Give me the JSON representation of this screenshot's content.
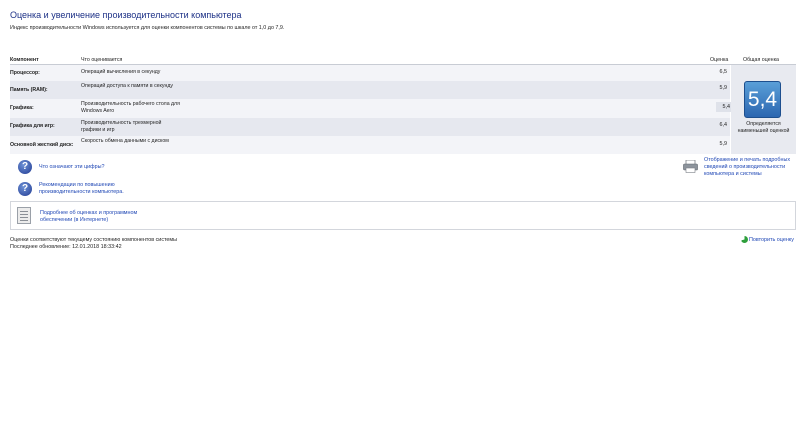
{
  "page": {
    "title": "Оценка и увеличение производительности компьютера",
    "intro": "Индекс производительности Windows используется для оценки компонентов системы по шкале от 1,0 до 7,9."
  },
  "table": {
    "headers": {
      "component": "Компонент",
      "what": "Что оценивается",
      "score": "Оценка",
      "base": "Общая оценка"
    },
    "rows": [
      {
        "component": "Процессор:",
        "description": "Операций вычисления в секунду",
        "score": "6,5"
      },
      {
        "component": "Память (RAM):",
        "description": "Операций доступа к памяти в секунду",
        "score": "5,9"
      },
      {
        "component": "Графика:",
        "description": "Производительность рабочего стола для Windows Aero",
        "score": "5,4"
      },
      {
        "component": "Графика для игр:",
        "description": "Производительность трехмерной графики и игр",
        "score": "6,4"
      },
      {
        "component": "Основной жесткий диск:",
        "description": "Скорость обмена данными с диском",
        "score": "5,9"
      }
    ],
    "base_score": "5,4",
    "base_note": "Определяется наименьшей оценкой"
  },
  "links": {
    "what_numbers": "Что означают эти цифры?",
    "tips": "Рекомендации по повышению производительности компьютера.",
    "print": "Отображение и печать подробных сведений о производительности компьютера и системы",
    "details": "Подробнее об оценках и программном обеспечении (в Интернете)",
    "rerun": "Повторить оценку"
  },
  "status": {
    "current": "Оценки соответствуют текущему состоянию компонентов системы",
    "updated": "Последнее обновление: 12.01.2018 18:33:42"
  },
  "colors": {
    "title": "#1e3287",
    "link": "#1f47b5",
    "badge": "#2b66b0"
  }
}
